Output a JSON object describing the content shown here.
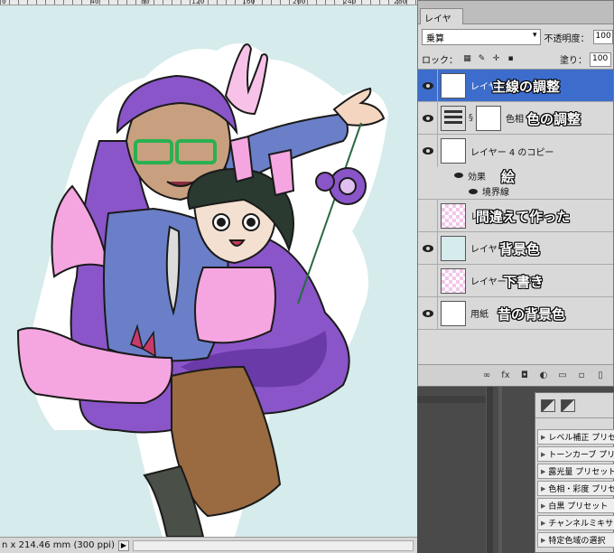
{
  "ruler": {
    "labels": [
      "0",
      "40",
      "80",
      "120",
      "160",
      "200",
      "240",
      "280"
    ]
  },
  "status": {
    "doc_size": "n x 214.46 mm (300 ppi)",
    "arrow": "▶"
  },
  "layers_panel": {
    "tab": "レイヤー",
    "blend_mode": "乗算",
    "opacity_label": "不透明度：",
    "opacity_value": "100",
    "lock_label": "ロック：",
    "fill_label": "塗り：",
    "fill_value": "100",
    "layers": [
      {
        "name": "レイヤー",
        "annotation": "主線の調整",
        "visible": true,
        "selected": true
      },
      {
        "name": "色相",
        "annotation": "色の調整",
        "visible": true,
        "selected": false
      },
      {
        "name": "レイヤー 4 のコピー",
        "annotation": "",
        "visible": true,
        "selected": false,
        "effects_label": "効果",
        "effects_annotation": "絵",
        "stroke_label": "境界線"
      },
      {
        "name": "レイヤー",
        "annotation": "間違えて作った",
        "visible": false,
        "selected": false
      },
      {
        "name": "レイヤー",
        "annotation": "背景色",
        "visible": true,
        "selected": false
      },
      {
        "name": "レイヤー",
        "annotation": "下書き",
        "visible": false,
        "selected": false
      },
      {
        "name": "用紙",
        "annotation": "昔の背景色",
        "visible": true,
        "selected": false
      }
    ],
    "footer_icons": [
      "link-icon",
      "fx-icon",
      "mask-icon",
      "adjustment-icon",
      "group-icon",
      "new-layer-icon",
      "trash-icon"
    ]
  },
  "adjustments": {
    "items": [
      "レベル補正 プリセ",
      "トーンカーブ プリセ",
      "露光量 プリセット",
      "色相・彩度 プリセ",
      "白黒 プリセット",
      "チャンネルミキサー",
      "特定色域の選択"
    ]
  },
  "colors": {
    "canvas_bg": "#d6ebeb",
    "selected_layer": "#3d6dcc",
    "panel_bg": "#d9d9d9",
    "hair_purple": "#8a55c8",
    "pink": "#f5a6e0",
    "blue_sweater": "#6a7fc8"
  }
}
